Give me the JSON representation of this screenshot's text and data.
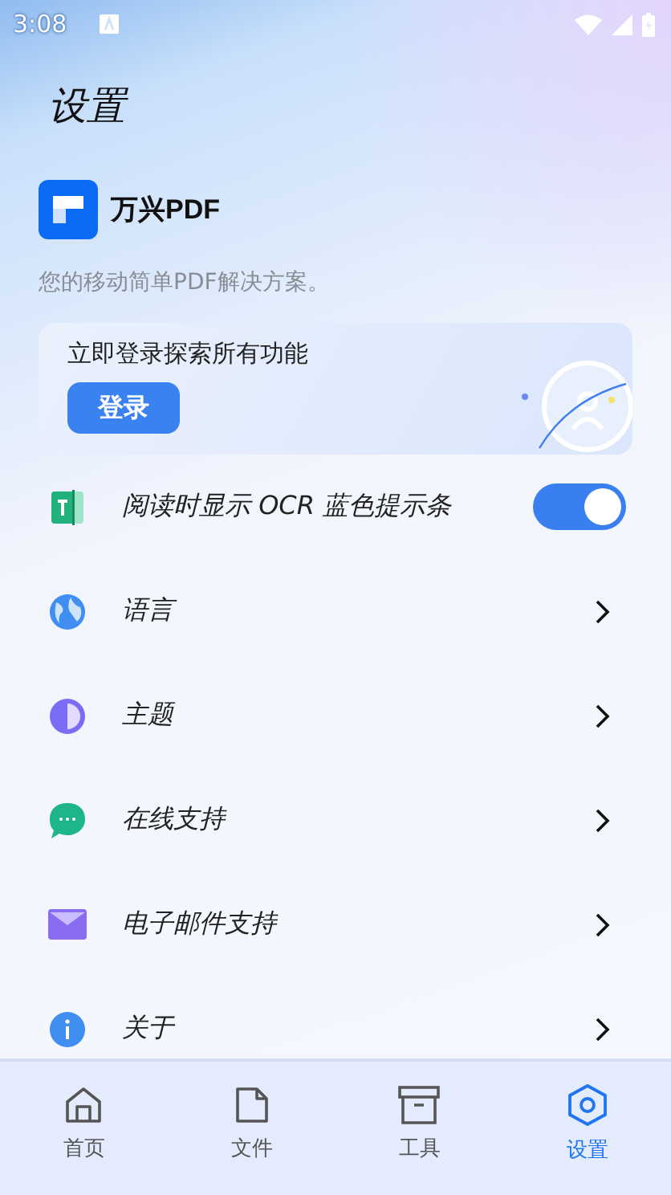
{
  "status_bar": {
    "time": "3:08"
  },
  "title": "设置",
  "brand": {
    "name": "万兴PDF",
    "tagline": "您的移动简单PDF解决方案。"
  },
  "login_card": {
    "text": "立即登录探索所有功能",
    "button": "登录"
  },
  "settings": [
    {
      "kind": "toggle",
      "label": "阅读时显示 OCR 蓝色提示条",
      "on": true
    },
    {
      "kind": "link",
      "label": "语言"
    },
    {
      "kind": "link",
      "label": "主题"
    },
    {
      "kind": "link",
      "label": "在线支持"
    },
    {
      "kind": "link",
      "label": "电子邮件支持"
    },
    {
      "kind": "link",
      "label": "关于"
    }
  ],
  "nav": [
    {
      "label": "首页",
      "selected": false
    },
    {
      "label": "文件",
      "selected": false
    },
    {
      "label": "工具",
      "selected": false
    },
    {
      "label": "设置",
      "selected": true
    }
  ]
}
